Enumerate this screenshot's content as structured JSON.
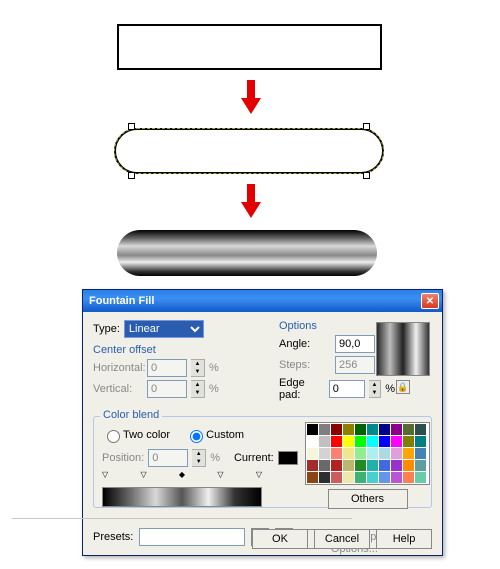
{
  "dialog": {
    "title": "Fountain Fill",
    "type_label": "Type:",
    "type_value": "Linear",
    "percent": "%",
    "center_offset": {
      "legend": "Center offset",
      "horizontal_label": "Horizontal:",
      "horizontal": "0",
      "vertical_label": "Vertical:",
      "vertical": "0"
    },
    "options": {
      "legend": "Options",
      "angle_label": "Angle:",
      "angle": "90,0",
      "steps_label": "Steps:",
      "steps": "256",
      "edge_label": "Edge pad:",
      "edge": "0"
    },
    "colorblend": {
      "legend": "Color blend",
      "two_color": "Two color",
      "custom": "Custom",
      "position_label": "Position:",
      "position": "0",
      "current_label": "Current:",
      "others": "Others"
    },
    "presets_label": "Presets:",
    "postscript": "PostScript Options...",
    "ok": "OK",
    "cancel": "Cancel",
    "help": "Help"
  },
  "palette_colors": [
    "#000000",
    "#7f7f7f",
    "#8b0000",
    "#8b8000",
    "#006400",
    "#008b8b",
    "#00008b",
    "#8b008b",
    "#556b2f",
    "#2f4f4f",
    "#ffffff",
    "#c0c0c0",
    "#ff0000",
    "#ffff00",
    "#00ff00",
    "#00ffff",
    "#0000ff",
    "#ff00ff",
    "#808000",
    "#008080",
    "#f5f5dc",
    "#d3d3d3",
    "#fa8072",
    "#f0e68c",
    "#90ee90",
    "#afeeee",
    "#add8e6",
    "#dda0dd",
    "#ffa500",
    "#4682b4",
    "#a52a2a",
    "#696969",
    "#b22222",
    "#bdb76b",
    "#228b22",
    "#20b2aa",
    "#4169e1",
    "#9932cc",
    "#ff8c00",
    "#5f9ea0",
    "#8b4513",
    "#2e2e2e",
    "#cd5c5c",
    "#eee8aa",
    "#3cb371",
    "#48d1cc",
    "#6495ed",
    "#ba55d3",
    "#ff7f50",
    "#66cdaa"
  ]
}
